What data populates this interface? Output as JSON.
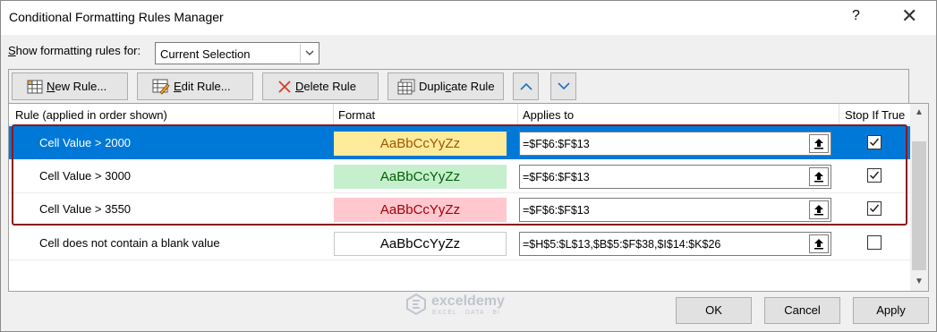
{
  "window": {
    "title": "Conditional Formatting Rules Manager",
    "help": "?",
    "close": "✕"
  },
  "show_rules": {
    "label_prefix": "S",
    "label_rest": "how formatting rules for:",
    "selected": "Current Selection"
  },
  "toolbar": {
    "new_rule": {
      "u": "N",
      "rest": "ew Rule..."
    },
    "edit_rule": {
      "u": "E",
      "rest": "dit Rule..."
    },
    "delete_rule": {
      "u": "D",
      "rest": "elete Rule"
    },
    "duplicate_rule": {
      "pre": "Dupli",
      "u": "c",
      "rest": "ate Rule"
    }
  },
  "columns": {
    "rule": "Rule (applied in order shown)",
    "format": "Format",
    "applies_to": "Applies to",
    "stop_if_true": "Stop If True"
  },
  "rules": [
    {
      "rule": "Cell Value > 2000",
      "preview": "AaBbCcYyZz",
      "bg": "#ffeb9c",
      "fg": "#9c5700",
      "applies_to": "=$F$6:$F$13",
      "stop_if_true": true,
      "selected": true
    },
    {
      "rule": "Cell Value > 3000",
      "preview": "AaBbCcYyZz",
      "bg": "#c6efce",
      "fg": "#006100",
      "applies_to": "=$F$6:$F$13",
      "stop_if_true": true,
      "selected": false
    },
    {
      "rule": "Cell Value > 3550",
      "preview": "AaBbCcYyZz",
      "bg": "#ffc7ce",
      "fg": "#9c0006",
      "applies_to": "=$F$6:$F$13",
      "stop_if_true": true,
      "selected": false
    },
    {
      "rule": "Cell does not contain a blank value",
      "preview": "AaBbCcYyZz",
      "bg": "#ffffff",
      "fg": "#000000",
      "applies_to": "=$H$5:$L$13,$B$5:$F$38,$I$14:$K$26",
      "stop_if_true": false,
      "selected": false
    }
  ],
  "watermark": {
    "name": "exceldemy",
    "tag": "EXCEL · DATA · BI"
  },
  "footer": {
    "ok": "OK",
    "cancel": "Cancel",
    "apply": "Apply"
  },
  "colors": {
    "selection": "#0078d7",
    "highlight_border": "#8b1a1a"
  }
}
